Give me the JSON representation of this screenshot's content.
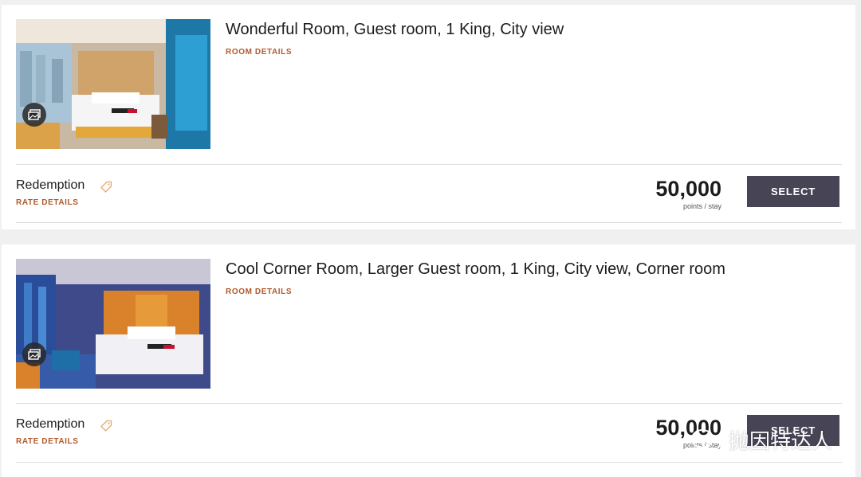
{
  "rooms": [
    {
      "title": "Wonderful Room, Guest room, 1 King, City view",
      "room_details_label": "ROOM DETAILS",
      "rate_name": "Redemption",
      "rate_details_label": "RATE DETAILS",
      "points": "50,000",
      "points_unit": "points / stay",
      "select_label": "SELECT"
    },
    {
      "title": "Cool Corner Room, Larger Guest room, 1 King, City view, Corner room",
      "room_details_label": "ROOM DETAILS",
      "rate_name": "Redemption",
      "rate_details_label": "RATE DETAILS",
      "points": "50,000",
      "points_unit": "points / stay",
      "select_label": "SELECT"
    }
  ],
  "watermark": {
    "text": "抛因特达人"
  },
  "icons": {
    "gallery": "gallery-icon",
    "tag": "tag-icon"
  },
  "colors": {
    "accent": "#b25a2a",
    "button": "#474456"
  }
}
